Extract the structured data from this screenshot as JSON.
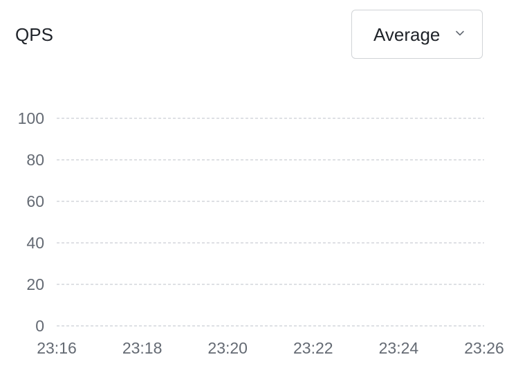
{
  "panel": {
    "title": "QPS"
  },
  "aggregation": {
    "selected": "Average",
    "icon": "chevron-down-icon"
  },
  "colors": {
    "text": "#1f2329",
    "axis_label": "#646a73",
    "grid": "#c9cdd4",
    "border": "#d0d3d6"
  },
  "chart_data": {
    "type": "line",
    "x": [
      "23:16",
      "23:18",
      "23:20",
      "23:22",
      "23:24",
      "23:26"
    ],
    "series": [],
    "ylim": [
      0,
      100
    ],
    "yticks": [
      0,
      20,
      40,
      60,
      80,
      100
    ],
    "grid": true,
    "grid_style": "dashed"
  }
}
